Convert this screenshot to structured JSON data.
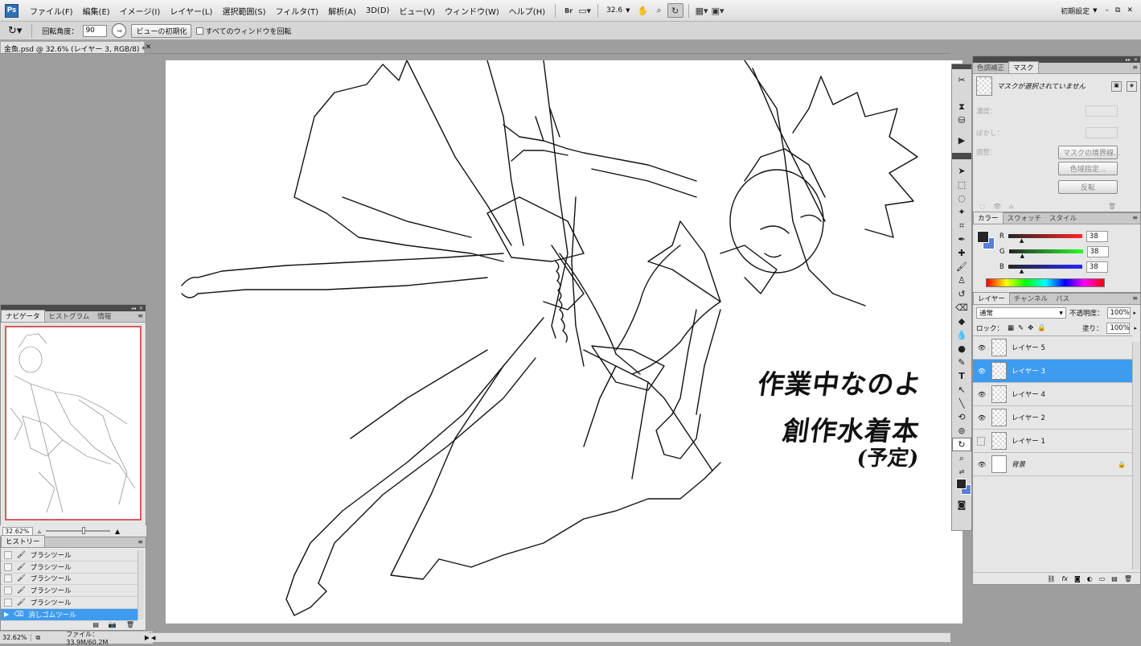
{
  "menubar": {
    "logo": "Ps",
    "items": [
      "ファイル(F)",
      "編集(E)",
      "イメージ(I)",
      "レイヤー(L)",
      "選択範囲(S)",
      "フィルタ(T)",
      "解析(A)",
      "3D(D)",
      "ビュー(V)",
      "ウィンドウ(W)",
      "ヘルプ(H)"
    ],
    "zoom_value": "32.6",
    "workspace": "初期設定"
  },
  "options": {
    "rotation_label": "回転角度：",
    "rotation_value": "90",
    "reset_view": "ビューの初期化",
    "rotate_all": "すべてのウィンドウを回転"
  },
  "document": {
    "tab_title": "金魚.psd @ 32.6% (レイヤー 3, RGB/8) *",
    "handwritten_line1": "作業中なのよ",
    "handwritten_line2": "創作水着本",
    "handwritten_line3": "(予定)"
  },
  "navigator": {
    "tabs": [
      "ナビゲータ",
      "ヒストグラム",
      "情報"
    ],
    "zoom": "32.62%"
  },
  "history": {
    "title": "ヒストリー",
    "items": [
      {
        "label": "ブラシツール",
        "selected": false
      },
      {
        "label": "ブラシツール",
        "selected": false
      },
      {
        "label": "ブラシツール",
        "selected": false
      },
      {
        "label": "ブラシツール",
        "selected": false
      },
      {
        "label": "ブラシツール",
        "selected": false
      },
      {
        "label": "消しゴムツール",
        "selected": true
      }
    ]
  },
  "status": {
    "zoom": "32.62%",
    "file_info": "ファイル：33.9M/60.2M"
  },
  "masks_panel": {
    "tabs": [
      "色調補正",
      "マスク"
    ],
    "message": "マスクが選択されていません",
    "density": "濃度：",
    "feather": "ぼかし：",
    "refine": "調整：",
    "mask_edge": "マスクの境界線...",
    "color_range": "色域指定...",
    "invert": "反転"
  },
  "color_panel": {
    "tabs": [
      "カラー",
      "スウォッチ",
      "スタイル"
    ],
    "r_label": "R",
    "g_label": "G",
    "b_label": "B",
    "r": "38",
    "g": "38",
    "b": "38",
    "foreground": "#262626",
    "background": "#5b7fd6"
  },
  "layers_panel": {
    "tabs": [
      "レイヤー",
      "チャンネル",
      "パス"
    ],
    "blend_mode": "通常",
    "opacity_label": "不透明度：",
    "opacity": "100%",
    "lock_label": "ロック：",
    "fill_label": "塗り：",
    "fill": "100%",
    "layers": [
      {
        "name": "レイヤー 5",
        "visible": true,
        "selected": false
      },
      {
        "name": "レイヤー 3",
        "visible": true,
        "selected": true
      },
      {
        "name": "レイヤー 4",
        "visible": true,
        "selected": false
      },
      {
        "name": "レイヤー 2",
        "visible": true,
        "selected": false
      },
      {
        "name": "レイヤー 1",
        "visible": false,
        "selected": false
      },
      {
        "name": "背景",
        "visible": true,
        "selected": false,
        "locked": true
      }
    ]
  }
}
